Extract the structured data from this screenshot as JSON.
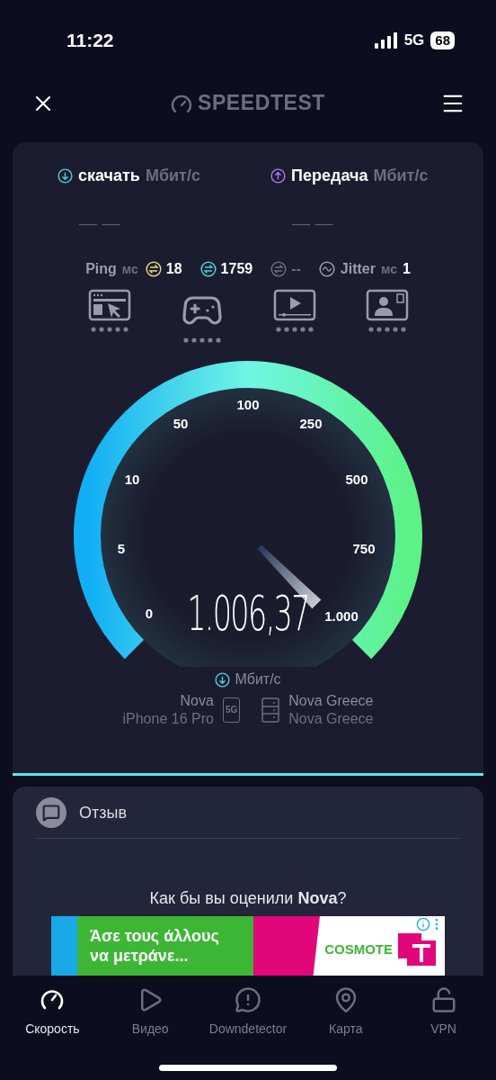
{
  "status_bar": {
    "time": "11:22",
    "network": "5G",
    "battery": "68"
  },
  "header": {
    "brand": "SPEEDTEST"
  },
  "results": [
    {
      "kind": "download",
      "label": "скачать",
      "unit": "Мбит/с",
      "value": "— —",
      "color": "#4fd1d9"
    },
    {
      "kind": "upload",
      "label": "Передача",
      "unit": "Мбит/с",
      "value": "— —",
      "color": "#a57cf5"
    }
  ],
  "latency": {
    "label": "Ping",
    "unit": "мс",
    "readings": [
      {
        "value": "18",
        "color": "#e8d77a"
      },
      {
        "value": "1759",
        "color": "#4fd1d9"
      },
      {
        "value": "--",
        "color": "#6b6f80"
      }
    ]
  },
  "jitter": {
    "label": "Jitter",
    "unit": "мс",
    "value": "1"
  },
  "quality": [
    {
      "kind": "browsing"
    },
    {
      "kind": "gaming"
    },
    {
      "kind": "video"
    },
    {
      "kind": "video_call"
    }
  ],
  "gauge": {
    "ticks": [
      "0",
      "5",
      "10",
      "50",
      "100",
      "250",
      "500",
      "750",
      "1.000"
    ],
    "value": "1.006,37",
    "unit": "Мбит/с"
  },
  "provider": {
    "name": "Nova",
    "device": "iPhone 16 Pro",
    "badge": "5G"
  },
  "server": {
    "name": "Nova Greece",
    "location": "Nova Greece"
  },
  "feedback": {
    "title": "Отзыв",
    "question": "Как бы вы оценили **Nova**?"
  },
  "ad": {
    "headline": "Άσε τους άλλους να μετράνε...",
    "brand": "COSMOTE"
  },
  "nav": [
    {
      "kind": "speed",
      "label": "Скорость",
      "selected": true
    },
    {
      "kind": "video",
      "label": "Видео",
      "selected": false
    },
    {
      "kind": "downdetector",
      "label": "Downdetector",
      "selected": false
    },
    {
      "kind": "map",
      "label": "Карта",
      "selected": false
    },
    {
      "kind": "vpn",
      "label": "VPN",
      "selected": false
    }
  ]
}
